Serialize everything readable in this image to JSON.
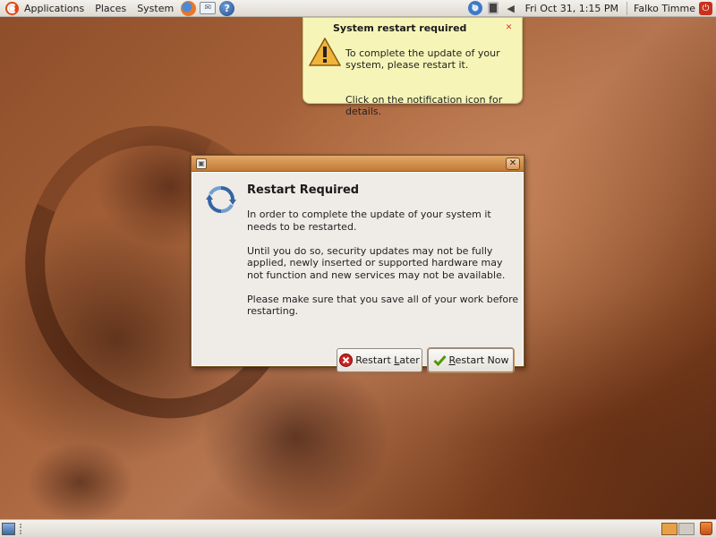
{
  "top_panel": {
    "menus": [
      "Applications",
      "Places",
      "System"
    ],
    "clock": "Fri Oct 31,  1:15 PM",
    "user": "Falko Timme"
  },
  "notification": {
    "title": "System restart required",
    "body_1": "To complete the update of your system, please restart it.",
    "body_2": "Click on the notification icon for details."
  },
  "dialog": {
    "heading": "Restart Required",
    "paragraph_1": "In order to complete the update of your system it needs to be restarted.",
    "paragraph_2": "Until you do so, security updates may not be fully applied, newly inserted or supported hardware may not function and new services may not be available.",
    "paragraph_3": "Please make sure that you save all of your work before restarting.",
    "restart_later": {
      "mnemonic_prefix": "Restart ",
      "mnemonic": "L",
      "rest": "ater"
    },
    "restart_now": {
      "mnemonic_prefix": "",
      "mnemonic": "R",
      "rest": "estart Now"
    }
  },
  "icons": {
    "top_panel": [
      "ubuntu-logo-icon",
      "firefox-icon",
      "evolution-mail-icon",
      "help-icon",
      "update-notifier-icon",
      "network-icon",
      "volume-icon",
      "shutdown-icon"
    ],
    "bottom_panel": [
      "show-desktop-icon",
      "workspace-switcher-icon",
      "trash-icon"
    ]
  },
  "colors": {
    "notification_bg": "#f6f5b7",
    "titlebar_accent": "#c17a36",
    "dialog_bg": "#efebe7",
    "wallpaper": "#a8643b"
  }
}
